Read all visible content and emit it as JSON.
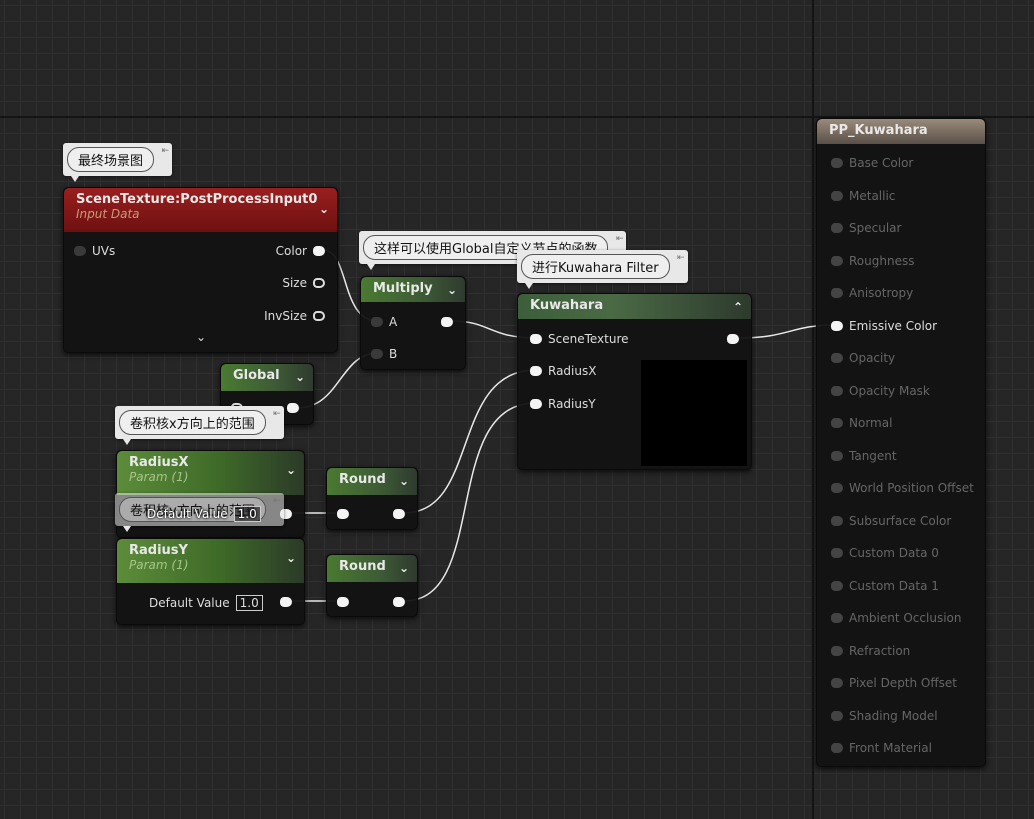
{
  "comments": {
    "scene": "最终场景图",
    "global": "这样可以使用Global自定义节点的函数",
    "kuwahara": "进行Kuwahara Filter",
    "radiusx": "卷积核x方向上的范围",
    "radiusy": "卷积核y方向上的范围"
  },
  "scene_texture": {
    "title": "SceneTexture:PostProcessInput0",
    "subtitle": "Input Data",
    "inputs": [
      "UVs"
    ],
    "outputs": [
      "Color",
      "Size",
      "InvSize"
    ],
    "color": "#8b1a1a"
  },
  "multiply": {
    "title": "Multiply",
    "inputs": [
      "A",
      "B"
    ]
  },
  "global": {
    "title": "Global"
  },
  "kuwahara": {
    "title": "Kuwahara",
    "inputs": [
      "SceneTexture",
      "RadiusX",
      "RadiusY"
    ]
  },
  "radius_x": {
    "title": "RadiusX",
    "subtitle": "Param (1)",
    "default_label": "Default Value",
    "default_value": "1.0"
  },
  "radius_y": {
    "title": "RadiusY",
    "subtitle": "Param (1)",
    "default_label": "Default Value",
    "default_value": "1.0"
  },
  "round": {
    "title": "Round"
  },
  "material": {
    "title": "PP_Kuwahara",
    "pins": [
      "Base Color",
      "Metallic",
      "Specular",
      "Roughness",
      "Anisotropy",
      "Emissive Color",
      "Opacity",
      "Opacity Mask",
      "Normal",
      "Tangent",
      "World Position Offset",
      "Subsurface Color",
      "Custom Data 0",
      "Custom Data 1",
      "Ambient Occlusion",
      "Refraction",
      "Pixel Depth Offset",
      "Shading Model",
      "Front Material"
    ],
    "active_pin": "Emissive Color"
  }
}
